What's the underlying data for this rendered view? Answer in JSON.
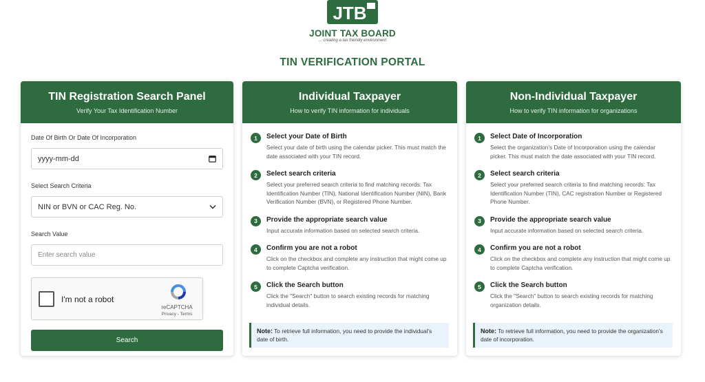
{
  "header": {
    "logo_text": "JTB",
    "org_name": "JOINT TAX BOARD",
    "tagline": "... creating a tax friendly environment",
    "portal_title": "TIN VERIFICATION PORTAL"
  },
  "search_panel": {
    "title": "TIN Registration Search Panel",
    "subtitle": "Verify Your Tax Identification Number",
    "dob_label": "Date Of Birth Or Date Of Incorporation",
    "dob_placeholder": "yyyy-mm-dd",
    "criteria_label": "Select Search Criteria",
    "criteria_value": "NIN or BVN or CAC Reg. No.",
    "value_label": "Search Value",
    "value_placeholder": "Enter search value",
    "captcha_text": "I'm not a robot",
    "captcha_brand": "reCAPTCHA",
    "captcha_links": "Privacy - Terms",
    "search_button": "Search"
  },
  "individual": {
    "title": "Individual Taxpayer",
    "subtitle": "How to verify TIN information for individuals",
    "steps": [
      {
        "num": "1",
        "title": "Select your Date of Birth",
        "desc": "Select your date of birth using the calendar picker. This must match the date associated with your TIN record."
      },
      {
        "num": "2",
        "title": "Select search criteria",
        "desc": "Select your preferred search criteria to find matching records: Tax Identification Number (TIN), National Identification Number (NIN), Bank Verification Number (BVN), or Registered Phone Number."
      },
      {
        "num": "3",
        "title": "Provide the appropriate search value",
        "desc": "Input accurate information based on selected search criteria."
      },
      {
        "num": "4",
        "title": "Confirm you are not a robot",
        "desc": "Click on the checkbox and complete any instruction that might come up to complete Captcha verification."
      },
      {
        "num": "5",
        "title": "Click the Search button",
        "desc": "Click the \"Search\" button to search existing records for matching individual details."
      }
    ],
    "note_label": "Note:",
    "note_text": "To retrieve full information, you need to provide the individual's date of birth."
  },
  "organization": {
    "title": "Non-Individual Taxpayer",
    "subtitle": "How to verify TIN information for organizations",
    "steps": [
      {
        "num": "1",
        "title": "Select Date of Incorporation",
        "desc": "Select the organization's Date of Incorporation using the calendar picker. This must match the date associated with your TIN record."
      },
      {
        "num": "2",
        "title": "Select search criteria",
        "desc": "Select your preferred search criteria to find matching records: Tax Identification Number (TIN), CAC registration Number or Registered Phone Number."
      },
      {
        "num": "3",
        "title": "Provide the appropriate search value",
        "desc": "Input accurate information based on selected search criteria."
      },
      {
        "num": "4",
        "title": "Confirm you are not a robot",
        "desc": "Click on the checkbox and complete any instruction that might come up to complete Captcha verification."
      },
      {
        "num": "5",
        "title": "Click the Search button",
        "desc": "Click the \"Search\" button to search existing records for matching organization details."
      }
    ],
    "note_label": "Note:",
    "note_text": "To retrieve full information, you need to provide the organization's date of incorporation."
  },
  "colors": {
    "brand_green": "#2e6b3f",
    "note_background": "#eaf3fb"
  },
  "icons": [
    "jtb-logo-icon",
    "calendar-icon",
    "chevron-down-icon",
    "recaptcha-icon"
  ]
}
